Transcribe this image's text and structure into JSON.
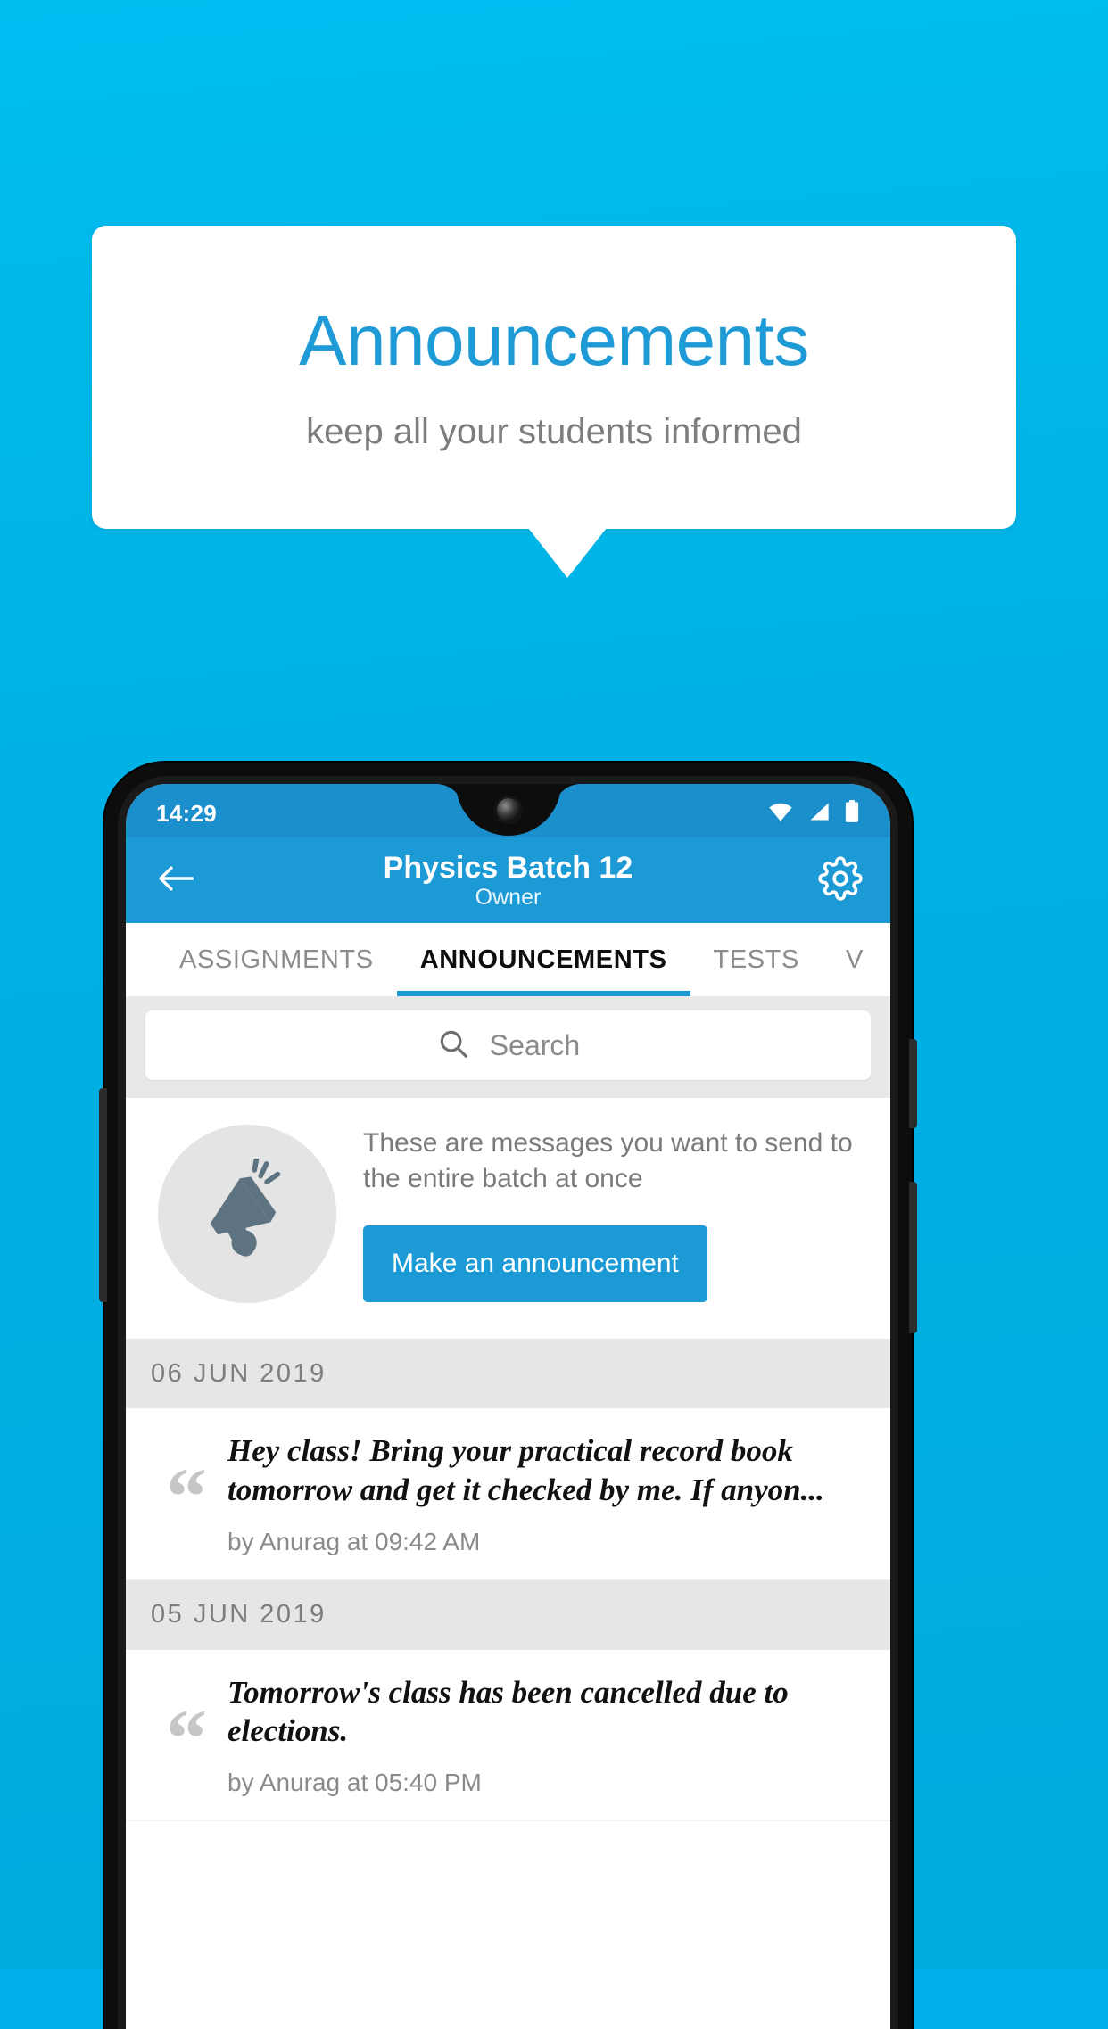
{
  "promo": {
    "title": "Announcements",
    "subtitle": "keep all your students informed",
    "title_color": "#1e9bd7",
    "background_color": "#00b0e8"
  },
  "phone": {
    "statusbar": {
      "time": "14:29",
      "icons": [
        "wifi-icon",
        "signal-icon",
        "battery-icon"
      ]
    },
    "appbar": {
      "back_icon": "back-arrow-icon",
      "title": "Physics Batch 12",
      "subtitle": "Owner",
      "settings_icon": "gear-icon",
      "color": "#1b9ad6"
    },
    "tabs": [
      {
        "label": "ASSIGNMENTS",
        "active": false
      },
      {
        "label": "ANNOUNCEMENTS",
        "active": true
      },
      {
        "label": "TESTS",
        "active": false
      },
      {
        "label": "V",
        "active": false
      }
    ],
    "search": {
      "icon": "search-icon",
      "placeholder": "Search",
      "value": ""
    },
    "empty_state": {
      "icon": "megaphone-icon",
      "text": "These are messages you want to send to the entire batch at once",
      "button_label": "Make an announcement",
      "button_color": "#1b9ad6"
    },
    "groups": [
      {
        "date": "06 JUN 2019",
        "items": [
          {
            "text": "Hey class! Bring your practical record book tomorrow and get it checked by me. If anyon...",
            "line1": "Hey class! Bring your practical record book",
            "line2": "tomorrow and get it checked by me. If anyon...",
            "meta": "by Anurag at 09:42 AM"
          }
        ]
      },
      {
        "date": "05 JUN 2019",
        "items": [
          {
            "text": "Tomorrow's class has been cancelled due to elections.",
            "line1": "Tomorrow's class has been cancelled due to",
            "line2": "elections.",
            "meta": "by Anurag at 05:40 PM"
          }
        ]
      }
    ]
  }
}
